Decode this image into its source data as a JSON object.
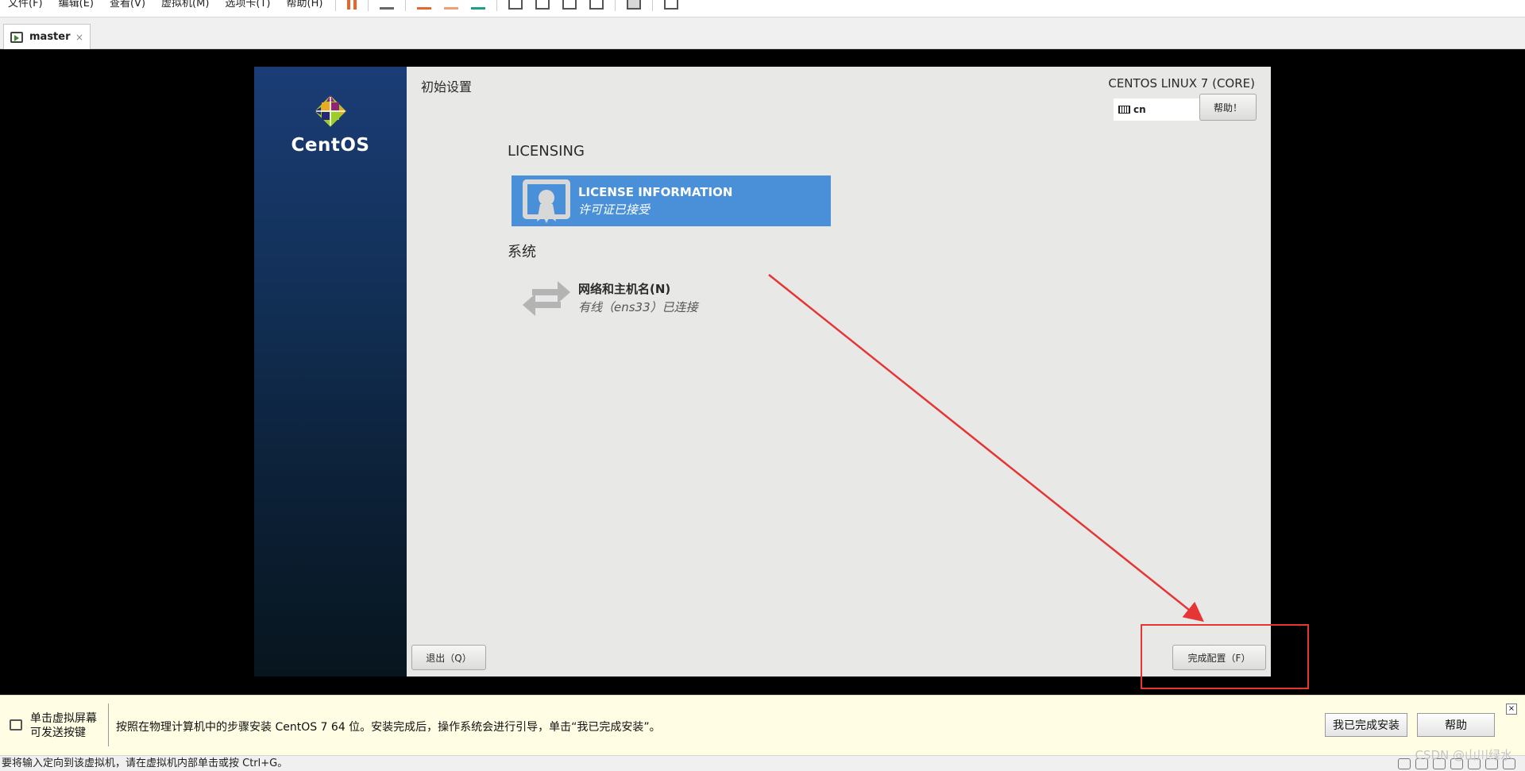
{
  "host": {
    "menus": [
      "文件(F)",
      "编辑(E)",
      "查看(V)",
      "虚拟机(M)",
      "选项卡(T)",
      "帮助(H)"
    ],
    "tab_label": "master",
    "tab_close": "×"
  },
  "installer": {
    "brand": "CentOS",
    "page_title": "初始设置",
    "product": "CENTOS LINUX 7 (CORE)",
    "keyboard_layout": "cn",
    "help_label": "帮助！",
    "sections": {
      "licensing": "LICENSING",
      "system": "系统"
    },
    "license_spoke": {
      "title": "LICENSE INFORMATION",
      "status": "许可证已接受"
    },
    "network_spoke": {
      "title": "网络和主机名(N)",
      "status": "有线（ens33）已连接"
    },
    "quit_label": "退出（Q）",
    "finish_label": "完成配置（F）"
  },
  "notification": {
    "hint": "单击虚拟屏幕 可发送按键",
    "message": "按照在物理计算机中的步骤安装 CentOS 7 64 位。安装完成后，操作系统会进行引导，单击“我已完成安装”。",
    "done_label": "我已完成安装",
    "help_label": "帮助",
    "close": "×"
  },
  "status_text": "要将输入定向到该虚拟机，请在虚拟机内部单击或按 Ctrl+G。",
  "watermark": "CSDN @山川绿水",
  "colors": {
    "selected_spoke": "#4a90d9",
    "annotation": "#e53535"
  }
}
